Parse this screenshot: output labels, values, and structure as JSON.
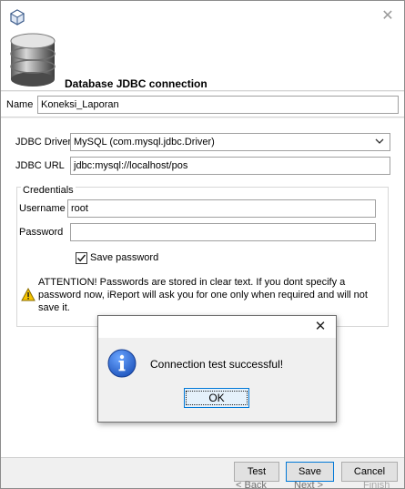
{
  "window": {
    "close_glyph": "✕",
    "header_title": "Database JDBC connection"
  },
  "form": {
    "name_label": "Name",
    "name_value": "Koneksi_Laporan",
    "driver_label": "JDBC Driver",
    "driver_value": "MySQL (com.mysql.jdbc.Driver)",
    "url_label": "JDBC URL",
    "url_value": "jdbc:mysql://localhost/pos",
    "credentials_legend": "Credentials",
    "username_label": "Username",
    "username_value": "root",
    "password_label": "Password",
    "password_value": "",
    "save_password_label": "Save password",
    "save_password_checked": true,
    "attention_text": "ATTENTION! Passwords are stored in clear text. If you dont specify a password now, iReport will ask you for one only when required and will not save it."
  },
  "buttons": {
    "test": "Test",
    "save": "Save",
    "cancel": "Cancel",
    "back": "< Back",
    "next": "Next >",
    "finish": "Finish"
  },
  "dialog": {
    "close_glyph": "✕",
    "message": "Connection test successful!",
    "ok": "OK"
  },
  "icons": {
    "app": "cube-icon",
    "database": "database-icon",
    "warning": "warning-icon",
    "info": "info-icon",
    "dropdown": "chevron-down-icon"
  },
  "colors": {
    "accent": "#0078d7",
    "info_blue": "#1c5fc7",
    "warning_yellow": "#f5c400"
  }
}
